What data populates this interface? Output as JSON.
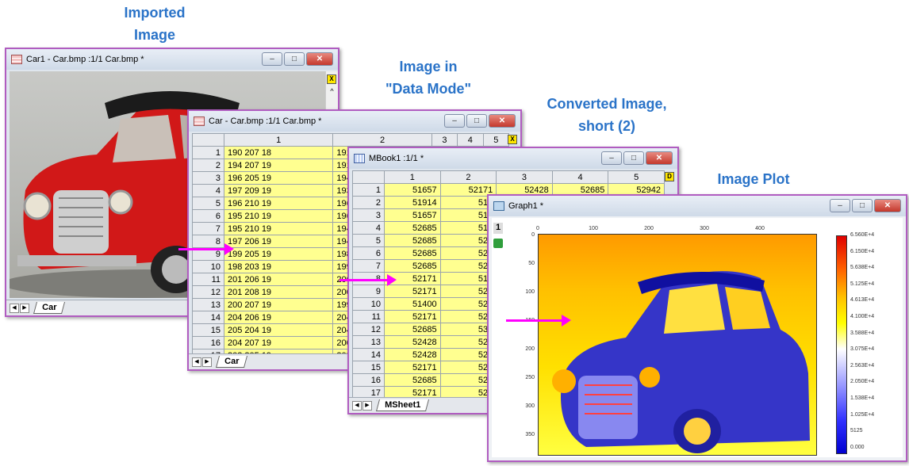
{
  "captions": {
    "imported": "Imported\nImage",
    "data_mode": "Image in\n\"Data Mode\"",
    "converted": "Converted Image,\nshort (2)",
    "image_plot": "Image Plot"
  },
  "windows": {
    "car1": {
      "title": "Car1 - Car.bmp :1/1 Car.bmp *",
      "sheet_tab": "Car"
    },
    "car": {
      "title": "Car - Car.bmp :1/1 Car.bmp *",
      "sheet_tab": "Car",
      "columns": [
        "1",
        "2",
        "3",
        "4",
        "5"
      ],
      "rows": [
        {
          "r": "1",
          "c1": "190 207 18",
          "c2": "191 210 1"
        },
        {
          "r": "2",
          "c1": "194 207 19",
          "c2": "191 208 1"
        },
        {
          "r": "3",
          "c1": "196 205 19",
          "c2": "194 207 1"
        },
        {
          "r": "4",
          "c1": "197 209 19",
          "c2": "193 207 1"
        },
        {
          "r": "5",
          "c1": "196 210 19",
          "c2": "196 210 1"
        },
        {
          "r": "6",
          "c1": "195 210 19",
          "c2": "196 210 1"
        },
        {
          "r": "7",
          "c1": "195 210 19",
          "c2": "194 209 1"
        },
        {
          "r": "8",
          "c1": "197 206 19",
          "c2": "194 207 1"
        },
        {
          "r": "9",
          "c1": "199 205 19",
          "c2": "198 207 1"
        },
        {
          "r": "10",
          "c1": "198 203 19",
          "c2": "199 208 1"
        },
        {
          "r": "11",
          "c1": "201 206 19",
          "c2": "200 208 1"
        },
        {
          "r": "12",
          "c1": "201 208 19",
          "c2": "200 211 2"
        },
        {
          "r": "13",
          "c1": "200 207 19",
          "c2": "199 208 1"
        },
        {
          "r": "14",
          "c1": "204 206 19",
          "c2": "204 208 1"
        },
        {
          "r": "15",
          "c1": "205 204 19",
          "c2": "204 207 1"
        },
        {
          "r": "16",
          "c1": "204 207 19",
          "c2": "200 209 1"
        },
        {
          "r": "17",
          "c1": "202 205 19",
          "c2": "202 210 1"
        }
      ]
    },
    "mbook": {
      "title": "MBook1 :1/1  *",
      "sheet_tab": "MSheet1",
      "columns": [
        "1",
        "2",
        "3",
        "4",
        "5"
      ],
      "rows": [
        {
          "r": "1",
          "c1": "51657",
          "c2": "52171",
          "c3": "52428",
          "c4": "52685",
          "c5": "52942"
        },
        {
          "r": "2",
          "c1": "51914",
          "c2": "519"
        },
        {
          "r": "3",
          "c1": "51657",
          "c2": "519"
        },
        {
          "r": "4",
          "c1": "52685",
          "c2": "519"
        },
        {
          "r": "5",
          "c1": "52685",
          "c2": "526"
        },
        {
          "r": "6",
          "c1": "52685",
          "c2": "526"
        },
        {
          "r": "7",
          "c1": "52685",
          "c2": "524"
        },
        {
          "r": "8",
          "c1": "52171",
          "c2": "519"
        },
        {
          "r": "9",
          "c1": "52171",
          "c2": "524"
        },
        {
          "r": "10",
          "c1": "51400",
          "c2": "524"
        },
        {
          "r": "11",
          "c1": "52171",
          "c2": "524"
        },
        {
          "r": "12",
          "c1": "52685",
          "c2": "531"
        },
        {
          "r": "13",
          "c1": "52428",
          "c2": "526"
        },
        {
          "r": "14",
          "c1": "52428",
          "c2": "526"
        },
        {
          "r": "15",
          "c1": "52171",
          "c2": "524"
        },
        {
          "r": "16",
          "c1": "52685",
          "c2": "526"
        },
        {
          "r": "17",
          "c1": "52171",
          "c2": "529"
        }
      ]
    },
    "graph": {
      "title": "Graph1 *",
      "layer": "1",
      "x_ticks": [
        "0",
        "100",
        "200",
        "300",
        "400"
      ],
      "y_ticks": [
        "0",
        "50",
        "100",
        "150",
        "200",
        "250",
        "300",
        "350"
      ],
      "colorbar": [
        "6.560E+4",
        "6.150E+4",
        "5.638E+4",
        "5.125E+4",
        "4.613E+4",
        "4.100E+4",
        "3.588E+4",
        "3.075E+4",
        "2.563E+4",
        "2.050E+4",
        "1.538E+4",
        "1.025E+4",
        "5125",
        "0.000"
      ]
    }
  }
}
